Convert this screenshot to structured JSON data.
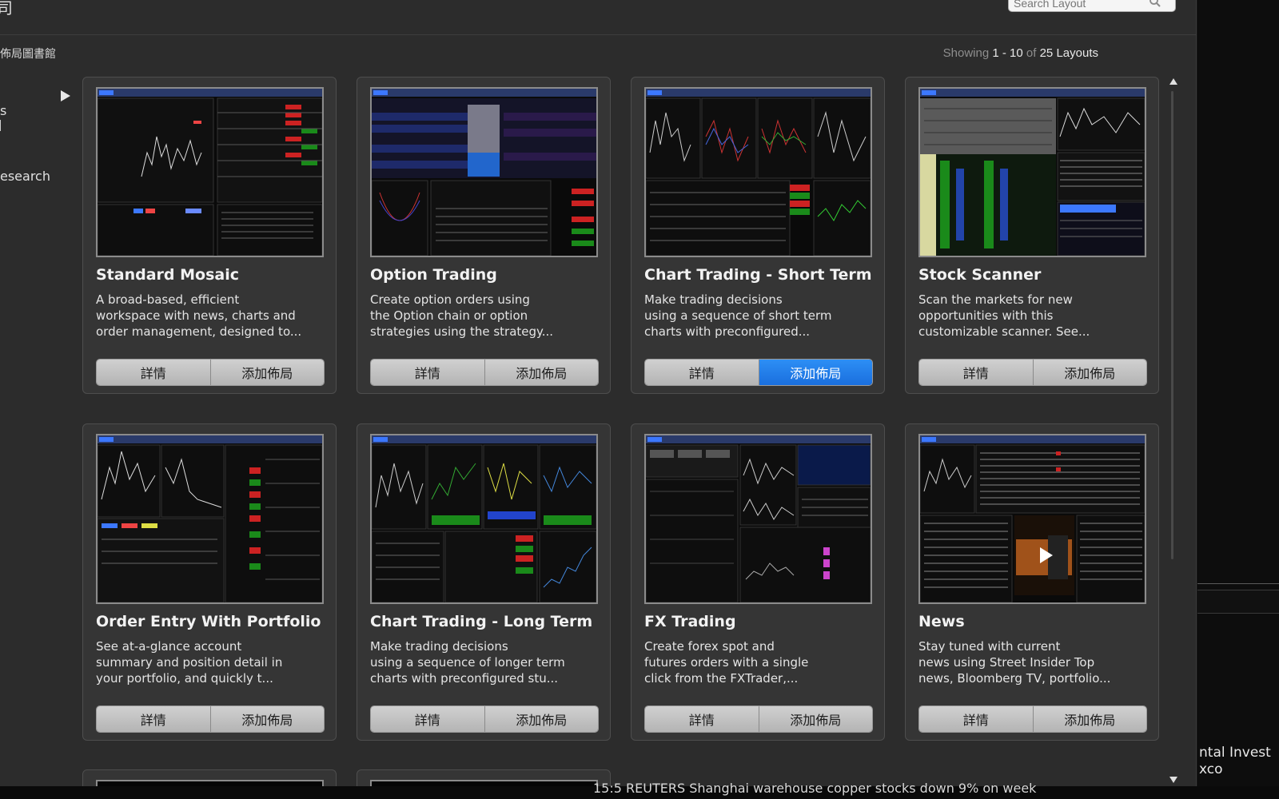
{
  "header": {
    "title_glyph": "司",
    "search_placeholder": "Search Layout"
  },
  "library": {
    "title": "佈局圖書館",
    "showing": {
      "prefix": "Showing",
      "from": "1",
      "dash": "-",
      "to": "10",
      "of": "of",
      "total": "25",
      "suffix": "Layouts"
    }
  },
  "sidebar": {
    "items": [
      {
        "label": "s"
      },
      {
        "label": "esearch"
      }
    ]
  },
  "buttons": {
    "details": "詳情",
    "add_layout": "添加佈局"
  },
  "colors": {
    "primary_button": "#1f7be8",
    "card_background": "#353535",
    "dialog_background": "#2c2c2c"
  },
  "cards": [
    {
      "title": "Standard Mosaic",
      "desc": [
        "A broad-based, efficient",
        "workspace with news, charts and",
        "order management, designed to..."
      ],
      "add_highlighted": false
    },
    {
      "title": "Option Trading",
      "desc": [
        "Create option orders using",
        "the Option chain or option",
        "strategies using the strategy..."
      ],
      "add_highlighted": false
    },
    {
      "title": "Chart Trading - Short Term",
      "desc": [
        "Make trading decisions",
        "using a sequence of short term",
        "charts with preconfigured..."
      ],
      "add_highlighted": true
    },
    {
      "title": "Stock Scanner",
      "desc": [
        "Scan the markets for new",
        "opportunities with this",
        "customizable scanner. See..."
      ],
      "add_highlighted": false
    },
    {
      "title": "Order Entry With Portfolio",
      "desc": [
        "See at-a-glance account",
        "summary and position detail in",
        "your portfolio, and quickly t..."
      ],
      "add_highlighted": false
    },
    {
      "title": "Chart Trading - Long Term",
      "desc": [
        "Make trading decisions",
        "using a sequence of longer term",
        "charts with preconfigured stu..."
      ],
      "add_highlighted": false
    },
    {
      "title": "FX Trading",
      "desc": [
        "Create forex spot and",
        "futures orders with a single",
        "click from the FXTrader,..."
      ],
      "add_highlighted": false
    },
    {
      "title": "News",
      "desc": [
        "Stay tuned with current",
        "news using Street Insider Top",
        "news, Bloomberg TV, portfolio..."
      ],
      "add_highlighted": false
    }
  ],
  "background_window": {
    "line1": "ntal Invest",
    "line2": "xco",
    "ticker": "15:5 REUTERS Shanghai warehouse copper stocks down 9% on week"
  }
}
